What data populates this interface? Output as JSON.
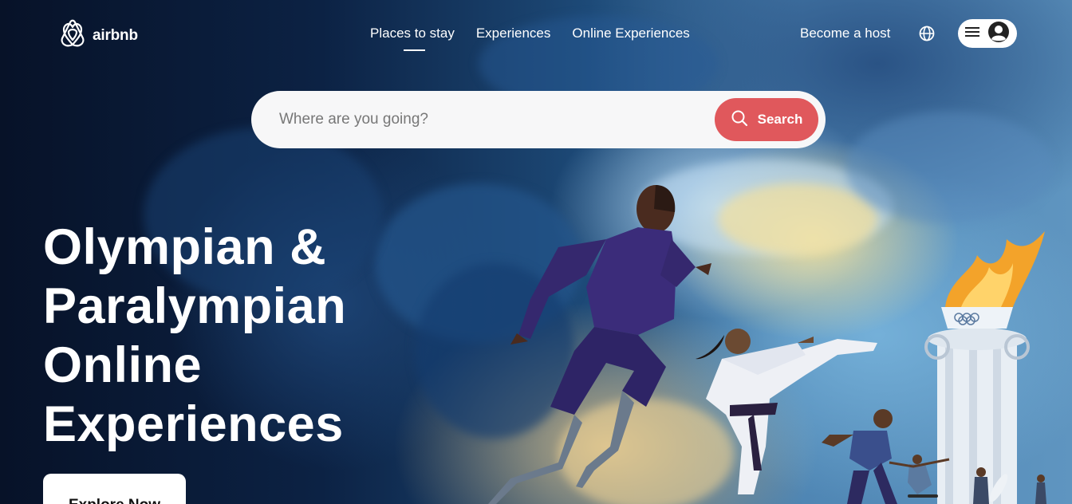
{
  "brand": {
    "name": "airbnb",
    "logo_icon": "airbnb-belo-icon"
  },
  "nav": {
    "items": [
      {
        "label": "Places to stay",
        "active": true
      },
      {
        "label": "Experiences",
        "active": false
      },
      {
        "label": "Online Experiences",
        "active": false
      }
    ],
    "host_label": "Become a host",
    "globe_icon": "globe-icon",
    "menu_icon": "hamburger-menu-icon",
    "profile_icon": "user-profile-icon"
  },
  "search": {
    "placeholder": "Where are you going?",
    "button_label": "Search",
    "button_icon": "search-icon"
  },
  "hero": {
    "headline_lines": [
      "Olympian &",
      "Paralympian",
      "Online",
      "Experiences"
    ],
    "cta_label": "Explore Now"
  },
  "colors": {
    "accent": "#e0585c",
    "text_on_dark": "#ffffff",
    "search_bg": "#f7f7f8"
  }
}
